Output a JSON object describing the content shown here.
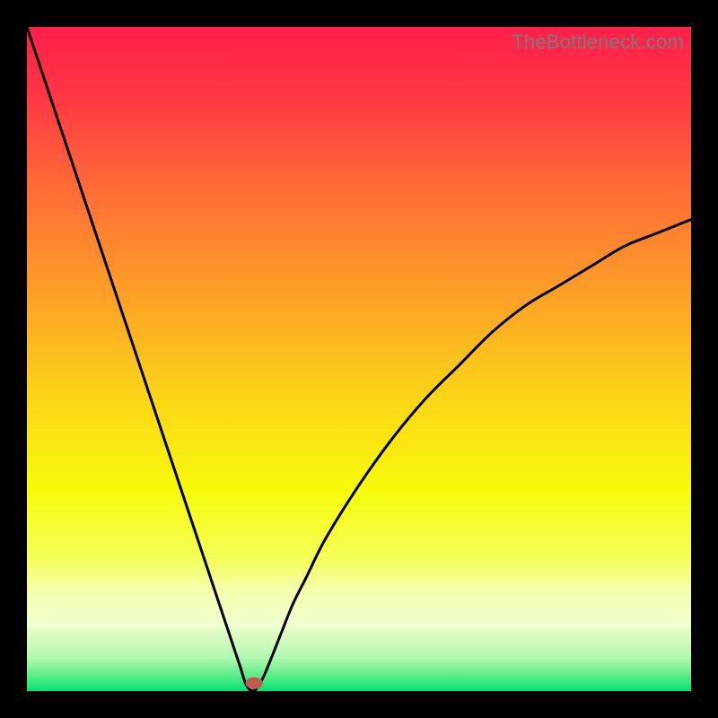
{
  "watermark": "TheBottleneck.com",
  "chart_data": {
    "type": "line",
    "title": "",
    "xlabel": "",
    "ylabel": "",
    "xlim": [
      0,
      100
    ],
    "ylim": [
      0,
      100
    ],
    "grid": false,
    "legend": false,
    "gradient_stops": [
      {
        "pos": 0.0,
        "color": "#ff1f4b"
      },
      {
        "pos": 0.1,
        "color": "#ff3545"
      },
      {
        "pos": 0.25,
        "color": "#fe6e36"
      },
      {
        "pos": 0.4,
        "color": "#fd9f27"
      },
      {
        "pos": 0.55,
        "color": "#fcd218"
      },
      {
        "pos": 0.7,
        "color": "#f7fb0b"
      },
      {
        "pos": 0.8,
        "color": "#f4fe58"
      },
      {
        "pos": 0.85,
        "color": "#f5feaf"
      },
      {
        "pos": 0.9,
        "color": "#effece"
      },
      {
        "pos": 0.95,
        "color": "#b1f8af"
      },
      {
        "pos": 0.975,
        "color": "#64ed8c"
      },
      {
        "pos": 1.0,
        "color": "#00e36f"
      }
    ],
    "series": [
      {
        "name": "bottleneck-curve",
        "stroke": "#000000",
        "stroke_width": 3,
        "x": [
          0,
          2,
          4,
          6,
          8,
          10,
          12,
          14,
          16,
          18,
          20,
          22,
          24,
          26,
          28,
          30,
          32,
          33,
          34,
          35,
          36,
          38,
          40,
          42,
          45,
          50,
          55,
          60,
          65,
          70,
          75,
          80,
          85,
          90,
          95,
          100
        ],
        "y": [
          100,
          94,
          88,
          82,
          76,
          70,
          64,
          58,
          52,
          46,
          40,
          34,
          28,
          22,
          16,
          10,
          4,
          1,
          0,
          1,
          3,
          8,
          13,
          17,
          23,
          31,
          38,
          44,
          49,
          54,
          58,
          61,
          64,
          67,
          69,
          71
        ]
      }
    ],
    "marker": {
      "x": 34.2,
      "y": 1.2,
      "rx": 1.3,
      "ry": 0.9,
      "color": "#c05a4d"
    }
  }
}
